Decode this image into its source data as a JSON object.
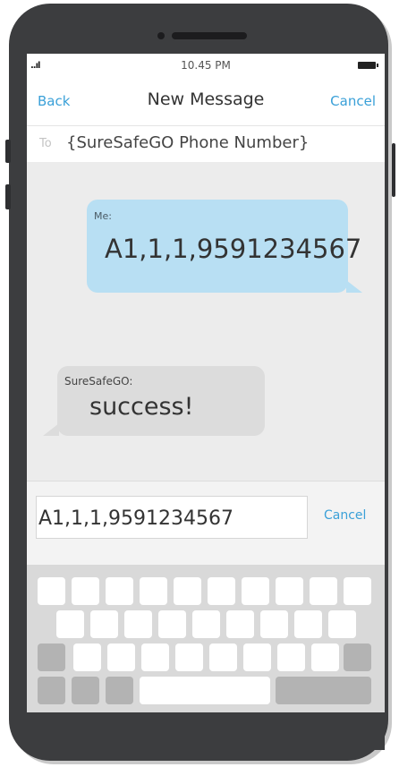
{
  "status_bar": {
    "signal": "..ıl",
    "time": "10.45 PM"
  },
  "nav": {
    "back_label": "Back",
    "title": "New Message",
    "cancel_label": "Cancel"
  },
  "recipient": {
    "label": "To",
    "value": "{SureSafeGO Phone Number}"
  },
  "messages": [
    {
      "sender": "Me:",
      "text": "A1,1,1,9591234567"
    },
    {
      "sender": "SureSafeGO:",
      "text": "success!"
    }
  ],
  "compose": {
    "value": "A1,1,1,9591234567",
    "cancel_label": "Cancel"
  },
  "colors": {
    "accent": "#3aa0d8",
    "sent_bubble": "#b8dff3",
    "received_bubble": "#dcdcdc",
    "phone_body": "#3c3d3f"
  }
}
